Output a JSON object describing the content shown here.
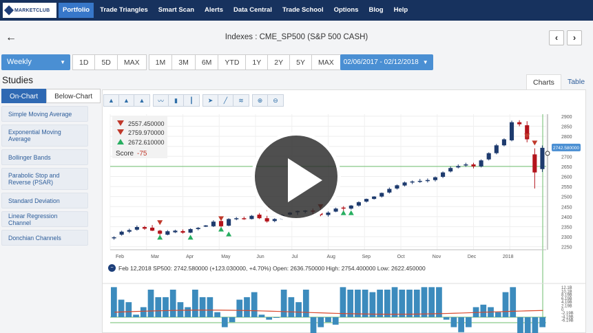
{
  "nav": {
    "logo": "MARKETCLUB",
    "items": [
      {
        "label": "Portfolio",
        "active": true
      },
      {
        "label": "Trade Triangles",
        "active": false
      },
      {
        "label": "Smart Scan",
        "active": false
      },
      {
        "label": "Alerts",
        "active": false
      },
      {
        "label": "Data Central",
        "active": false
      },
      {
        "label": "Trade School",
        "active": false
      },
      {
        "label": "Options",
        "active": false
      },
      {
        "label": "Blog",
        "active": false
      },
      {
        "label": "Help",
        "active": false
      }
    ]
  },
  "header": {
    "title": "Indexes : CME_SP500 (S&P 500 CASH)",
    "back_icon": "←",
    "prev_icon": "‹",
    "next_icon": "›"
  },
  "toolbar": {
    "period": "Weekly",
    "ranges_a": [
      "1D",
      "5D",
      "MAX"
    ],
    "ranges_b": [
      "1M",
      "3M",
      "6M",
      "YTD",
      "1Y",
      "2Y",
      "5Y",
      "MAX"
    ],
    "date_range": "02/06/2017 - 02/12/2018"
  },
  "studies": {
    "title": "Studies",
    "tabs": [
      "On-Chart",
      "Below-Chart"
    ],
    "items": [
      "Simple Moving Average",
      "Exponential Moving Average",
      "Bollinger Bands",
      "Parabolic Stop and Reverse (PSAR)",
      "Standard Deviation",
      "Linear Regression Channel",
      "Donchian Channels"
    ]
  },
  "chart_tabs": [
    "Charts",
    "Table"
  ],
  "triangles": {
    "values": [
      "2557.450000",
      "2759.970000",
      "2672.610000"
    ],
    "directions": [
      "down",
      "down",
      "up"
    ],
    "score_label": "Score",
    "score_value": "-75"
  },
  "info_line": "Feb 12,2018 SP500: 2742.580000 (+123.030000, +4.70%) Open: 2636.750000 High: 2754.400000 Low: 2622.450000",
  "chart_data": {
    "type": "candlestick",
    "x_labels": [
      "Feb",
      "Mar",
      "Apr",
      "May",
      "Jun",
      "Jul",
      "Aug",
      "Sep",
      "Oct",
      "Nov",
      "Dec",
      "2018"
    ],
    "y_ticks": [
      2250,
      2300,
      2350,
      2400,
      2450,
      2500,
      2550,
      2600,
      2650,
      2700,
      2750,
      2800,
      2850,
      2900
    ],
    "ylim": [
      2235,
      2910
    ],
    "last_price_label": "2742.580000",
    "last_price": 2742.58,
    "reference_line": 2650,
    "candles": [
      [
        2292,
        2302,
        2285,
        2297
      ],
      [
        2310,
        2330,
        2305,
        2325
      ],
      [
        2325,
        2340,
        2318,
        2333
      ],
      [
        2335,
        2356,
        2330,
        2348
      ],
      [
        2348,
        2354,
        2334,
        2340
      ],
      [
        2345,
        2358,
        2328,
        2330
      ],
      [
        2330,
        2334,
        2308,
        2315
      ],
      [
        2310,
        2333,
        2307,
        2327
      ],
      [
        2322,
        2335,
        2318,
        2330
      ],
      [
        2328,
        2336,
        2315,
        2320
      ],
      [
        2320,
        2342,
        2318,
        2338
      ],
      [
        2338,
        2348,
        2332,
        2344
      ],
      [
        2350,
        2358,
        2348,
        2356
      ],
      [
        2352,
        2382,
        2348,
        2375
      ],
      [
        2378,
        2384,
        2348,
        2352
      ],
      [
        2355,
        2392,
        2352,
        2388
      ],
      [
        2388,
        2398,
        2382,
        2392
      ],
      [
        2392,
        2400,
        2384,
        2390
      ],
      [
        2388,
        2408,
        2386,
        2404
      ],
      [
        2410,
        2418,
        2388,
        2392
      ],
      [
        2392,
        2404,
        2370,
        2376
      ],
      [
        2378,
        2392,
        2372,
        2388
      ],
      [
        2388,
        2412,
        2385,
        2408
      ],
      [
        2410,
        2424,
        2405,
        2420
      ],
      [
        2422,
        2430,
        2408,
        2428
      ],
      [
        2428,
        2432,
        2416,
        2430
      ],
      [
        2430,
        2440,
        2410,
        2425
      ],
      [
        2425,
        2438,
        2402,
        2408
      ],
      [
        2408,
        2426,
        2400,
        2420
      ],
      [
        2425,
        2445,
        2422,
        2440
      ],
      [
        2445,
        2452,
        2425,
        2442
      ],
      [
        2440,
        2458,
        2435,
        2455
      ],
      [
        2455,
        2476,
        2450,
        2472
      ],
      [
        2475,
        2490,
        2470,
        2488
      ],
      [
        2488,
        2502,
        2485,
        2500
      ],
      [
        2500,
        2520,
        2495,
        2518
      ],
      [
        2520,
        2545,
        2515,
        2538
      ],
      [
        2540,
        2560,
        2535,
        2556
      ],
      [
        2555,
        2575,
        2550,
        2570
      ],
      [
        2572,
        2580,
        2562,
        2575
      ],
      [
        2575,
        2588,
        2568,
        2578
      ],
      [
        2580,
        2590,
        2570,
        2582
      ],
      [
        2582,
        2600,
        2575,
        2596
      ],
      [
        2598,
        2625,
        2592,
        2620
      ],
      [
        2625,
        2650,
        2620,
        2642
      ],
      [
        2645,
        2660,
        2640,
        2652
      ],
      [
        2655,
        2668,
        2648,
        2660
      ],
      [
        2660,
        2668,
        2640,
        2650
      ],
      [
        2650,
        2685,
        2645,
        2680
      ],
      [
        2685,
        2720,
        2680,
        2716
      ],
      [
        2716,
        2762,
        2710,
        2755
      ],
      [
        2755,
        2790,
        2750,
        2785
      ],
      [
        2780,
        2878,
        2775,
        2870
      ],
      [
        2870,
        2880,
        2850,
        2860
      ],
      [
        2855,
        2875,
        2770,
        2785
      ],
      [
        2710,
        2740,
        2540,
        2620
      ],
      [
        2636.75,
        2754.4,
        2622.45,
        2742.58
      ]
    ],
    "triangle_markers": [
      {
        "index": 6,
        "price": 2368,
        "type": "down"
      },
      {
        "index": 6,
        "price": 2296,
        "type": "up"
      },
      {
        "index": 10,
        "price": 2296,
        "type": "up"
      },
      {
        "index": 14,
        "price": 2388,
        "type": "down"
      },
      {
        "index": 14,
        "price": 2336,
        "type": "up"
      },
      {
        "index": 15,
        "price": 2312,
        "type": "up"
      },
      {
        "index": 20,
        "price": 2436,
        "type": "down"
      },
      {
        "index": 27,
        "price": 2448,
        "type": "down"
      },
      {
        "index": 30,
        "price": 2418,
        "type": "up"
      },
      {
        "index": 31,
        "price": 2418,
        "type": "up"
      },
      {
        "index": 54,
        "price": 2800,
        "type": "down"
      },
      {
        "index": 55,
        "price": 2765,
        "type": "down"
      }
    ],
    "volume_ticks": [
      "12.1B",
      "10.1B",
      "8.19B",
      "6.19B",
      "4.19B",
      "2.19B",
      "0",
      "-2.19B",
      "-4.19B",
      "-6.19B"
    ],
    "volume": [
      12,
      7,
      6,
      1,
      4,
      11,
      8,
      8,
      11,
      6,
      4,
      11,
      8,
      8,
      2,
      -4,
      -2,
      7,
      8,
      10,
      1,
      -1,
      0,
      11,
      8,
      6,
      11,
      -7,
      -4,
      -2,
      -3,
      12,
      11,
      11,
      11,
      10,
      11,
      11,
      12,
      11,
      11,
      11,
      12,
      12,
      12,
      -1,
      -4,
      -6,
      -4,
      4,
      5,
      4,
      2,
      10,
      12,
      -8,
      -9,
      -8,
      -4
    ]
  }
}
